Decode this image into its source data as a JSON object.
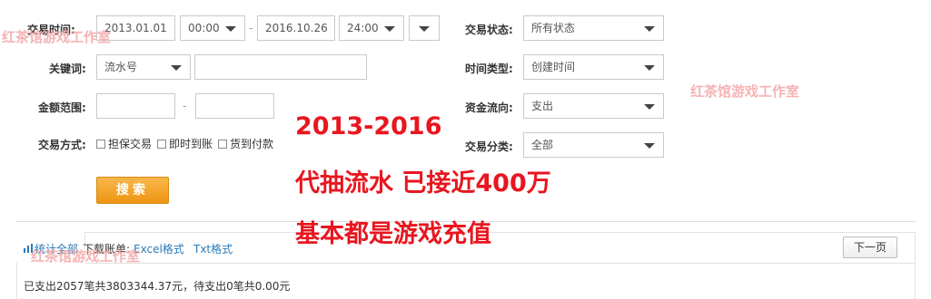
{
  "filters": {
    "trade_time_label": "交易时间:",
    "date_from": "2013.01.01",
    "time_from": "00:00",
    "range_dash": "-",
    "date_to": "2016.10.26",
    "time_to": "24:00",
    "keyword_label": "关键词:",
    "keyword_type": "流水号",
    "keyword_value": "",
    "amount_label": "金额范围:",
    "amount_min": "",
    "amount_max": "",
    "amount_dash": "-",
    "trade_mode_label": "交易方式:",
    "mode_options": [
      "担保交易",
      "即时到账",
      "货到付款"
    ],
    "trade_status_label": "交易状态:",
    "trade_status_value": "所有状态",
    "time_type_label": "时间类型:",
    "time_type_value": "创建时间",
    "fund_flow_label": "资金流向:",
    "fund_flow_value": "支出",
    "trade_category_label": "交易分类:",
    "trade_category_value": "全部",
    "search_button": "搜索"
  },
  "toolbar": {
    "stat_tab": "统计全部",
    "download_label": "下载账单:",
    "excel_link": "Excel格式",
    "txt_link": "Txt格式",
    "next_page": "下一页"
  },
  "summary": {
    "text": "已支出2057笔共3803344.37元，待支出0笔共0.00元"
  },
  "annotation": {
    "line1": "2013-2016",
    "line2": "代抽流水 已接近400万",
    "line3": "基本都是游戏充值"
  },
  "watermark": {
    "text": "红茶馆游戏工作室"
  },
  "colors": {
    "annotation_red": "#e8161f",
    "watermark_pink": "#f4a6a6",
    "search_orange": "#f0a02a",
    "link_blue": "#2a7ab8"
  }
}
